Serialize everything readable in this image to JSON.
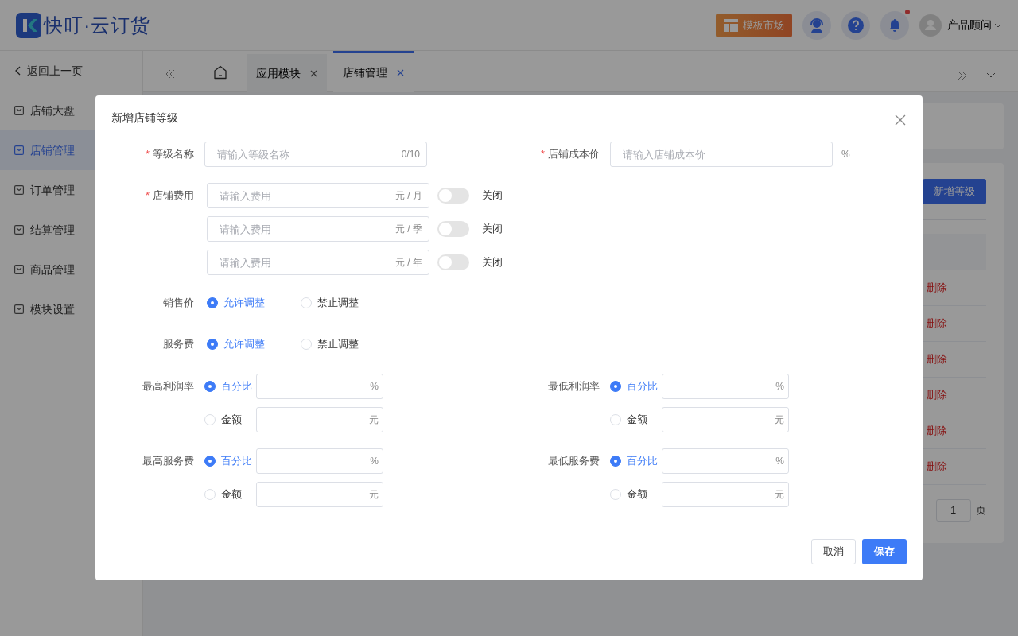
{
  "header": {
    "logo_text": "快叮·云订货",
    "template_button": "模板市场",
    "notification_unread": true,
    "user": "产品顾问"
  },
  "sidebar": {
    "back": "返回上一页",
    "items": [
      {
        "label": "店铺大盘",
        "selected": false
      },
      {
        "label": "店铺管理",
        "selected": true
      },
      {
        "label": "订单管理",
        "selected": false
      },
      {
        "label": "结算管理",
        "selected": false
      },
      {
        "label": "商品管理",
        "selected": false
      },
      {
        "label": "模块设置",
        "selected": false
      }
    ]
  },
  "tabs": [
    {
      "label": "应用模块",
      "selected": false
    },
    {
      "label": "店铺管理",
      "selected": true
    }
  ],
  "page": {
    "add_button": "新增等级",
    "row_actions": [
      "删除",
      "删除",
      "删除",
      "删除",
      "删除",
      "删除"
    ],
    "page_input": "1",
    "page_suffix": "页"
  },
  "dialog": {
    "title": "新增店铺等级",
    "level_name": {
      "label": "等级名称",
      "required_mark": "*",
      "placeholder": "请输入等级名称",
      "counter": "0/10"
    },
    "cost_price": {
      "label": "店铺成本价",
      "required_mark": "*",
      "placeholder": "请输入店铺成本价",
      "unit": "%"
    },
    "store_fee": {
      "label": "店铺费用",
      "required_mark": "*",
      "rows": [
        {
          "placeholder": "请输入费用",
          "unit": "元 / 月",
          "on": false,
          "state_label": "关闭"
        },
        {
          "placeholder": "请输入费用",
          "unit": "元 / 季",
          "on": false,
          "state_label": "关闭"
        },
        {
          "placeholder": "请输入费用",
          "unit": "元 / 年",
          "on": false,
          "state_label": "关闭"
        }
      ]
    },
    "radio_groups": [
      {
        "label": "销售价",
        "options": [
          {
            "label": "允许调整",
            "selected": true
          },
          {
            "label": "禁止调整",
            "selected": false
          }
        ]
      },
      {
        "label": "服务费",
        "options": [
          {
            "label": "允许调整",
            "selected": true
          },
          {
            "label": "禁止调整",
            "selected": false
          }
        ]
      }
    ],
    "limits": [
      {
        "label": "最高利润率",
        "options": [
          {
            "label": "百分比",
            "selected": true,
            "unit": "%"
          },
          {
            "label": "金额",
            "selected": false,
            "unit": "元"
          }
        ]
      },
      {
        "label": "最低利润率",
        "options": [
          {
            "label": "百分比",
            "selected": true,
            "unit": "%"
          },
          {
            "label": "金额",
            "selected": false,
            "unit": "元"
          }
        ]
      },
      {
        "label": "最高服务费",
        "options": [
          {
            "label": "百分比",
            "selected": true,
            "unit": "%"
          },
          {
            "label": "金额",
            "selected": false,
            "unit": "元"
          }
        ]
      },
      {
        "label": "最低服务费",
        "options": [
          {
            "label": "百分比",
            "selected": true,
            "unit": "%"
          },
          {
            "label": "金额",
            "selected": false,
            "unit": "元"
          }
        ]
      }
    ],
    "cancel_button": "取消",
    "save_button": "保存"
  }
}
